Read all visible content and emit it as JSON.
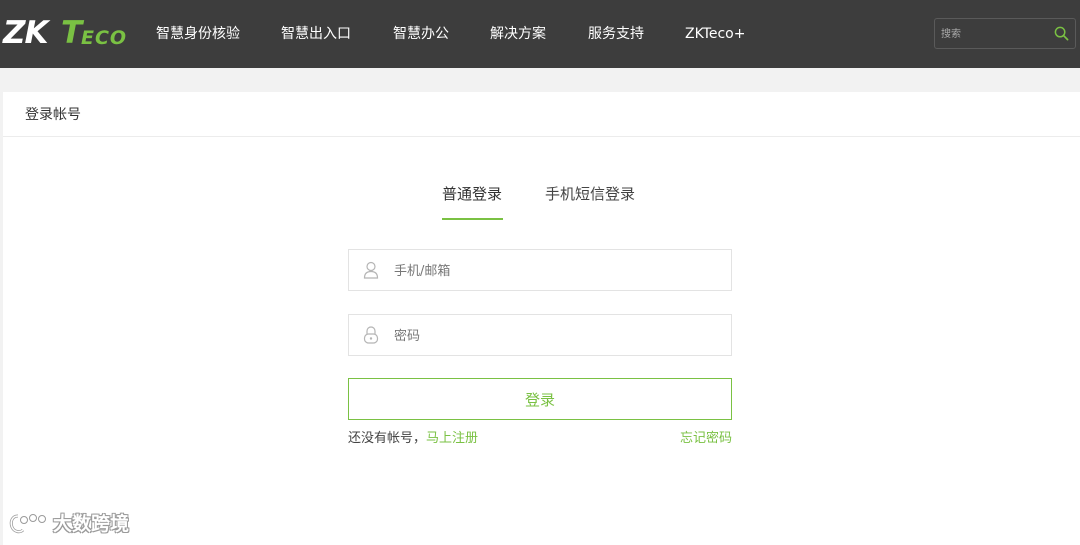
{
  "brand": {
    "logo_zk": "ZK",
    "logo_t": "T",
    "logo_eco": "ECO"
  },
  "nav": {
    "items": [
      "智慧身份核验",
      "智慧出入口",
      "智慧办公",
      "解决方案",
      "服务支持",
      "ZKTeco+"
    ]
  },
  "search": {
    "placeholder": "搜索",
    "icon": "search-icon"
  },
  "panel": {
    "title": "登录帐号"
  },
  "tabs": [
    {
      "label": "普通登录",
      "active": true
    },
    {
      "label": "手机短信登录",
      "active": false
    }
  ],
  "form": {
    "account_placeholder": "手机/邮箱",
    "account_icon": "user-icon",
    "password_placeholder": "密码",
    "password_icon": "lock-icon",
    "submit_label": "登录",
    "no_account_text": "还没有帐号，",
    "register_link": "马上注册",
    "forgot_link": "忘记密码"
  },
  "watermark": {
    "text": "大数跨境"
  },
  "colors": {
    "accent": "#7ac143",
    "topbar": "#3d3d3d",
    "background": "#f2f2f2"
  }
}
